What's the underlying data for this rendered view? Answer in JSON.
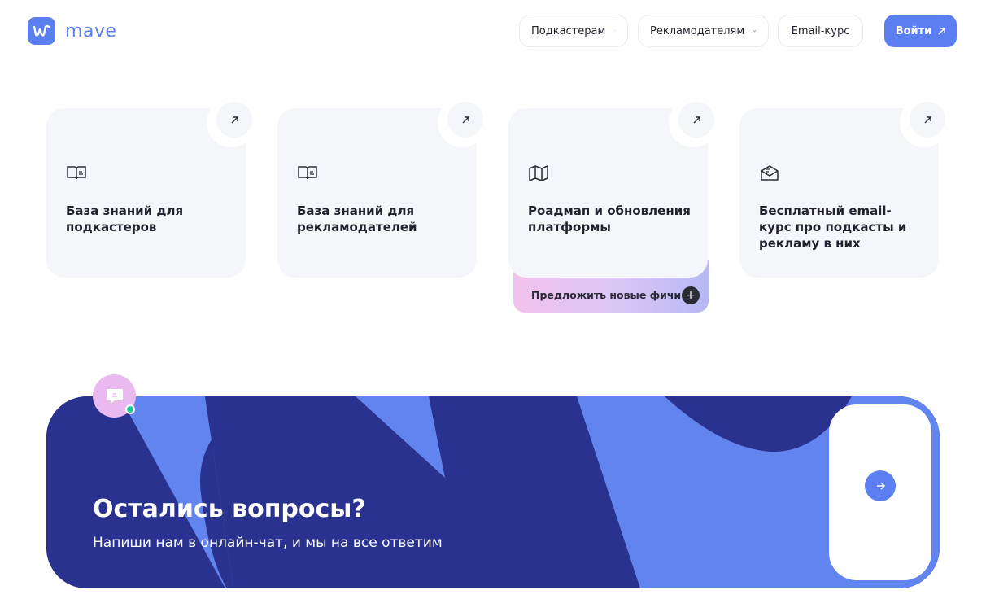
{
  "brand": {
    "logo_text": "mave",
    "accent": "#5b7ff0"
  },
  "header": {
    "nav": [
      {
        "label": "Подкастерам",
        "has_dropdown": true
      },
      {
        "label": "Рекламодателям",
        "has_dropdown": true
      },
      {
        "label": "Email-курс",
        "has_dropdown": false
      }
    ],
    "login_label": "Войти"
  },
  "cards": [
    {
      "title": "База знаний для подкастеров",
      "icon": "book-icon"
    },
    {
      "title": "База знаний для рекламодателей",
      "icon": "book-icon"
    },
    {
      "title": "Роадмап и обновления платформы",
      "icon": "map-icon"
    },
    {
      "title": "Бесплатный email-курс про подкасты и рекламу в них",
      "icon": "mail-icon"
    }
  ],
  "suggest": {
    "label": "Предложить новые фичи"
  },
  "banner": {
    "title": "Остались вопросы?",
    "subtitle": "Напиши нам в онлайн-чат, и мы на все ответим",
    "colors": {
      "dark": "#2a3290",
      "light": "#6284ef"
    }
  }
}
